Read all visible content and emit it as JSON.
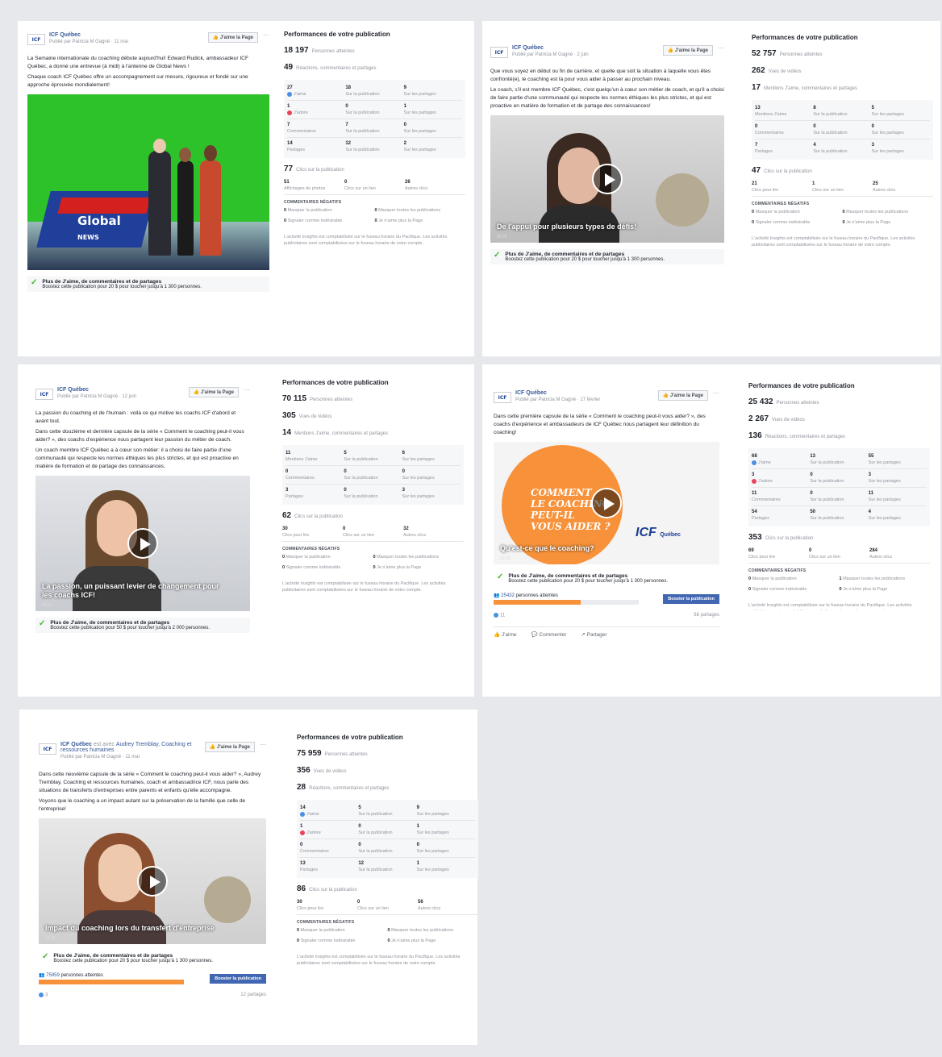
{
  "common": {
    "page_name": "ICF Québec",
    "like_page": "J'aime la Page",
    "perf_title": "Performances de votre publication",
    "reached": "Personnes atteintes",
    "video_views": "Vues de vidéos",
    "reactions": "Réactions, commentaires et partages",
    "mentions": "Mentions J'aime, commentaires et partages",
    "clicks": "Clics sur la publication",
    "lbl_like": "J'aime",
    "lbl_love": "J'adore",
    "lbl_mentions_like": "Mentions J'aime",
    "lbl_comments": "Commentaires",
    "lbl_shares": "Partages",
    "lbl_on_post": "Sur la publication",
    "lbl_on_shares": "Sur les partages",
    "lbl_photo_views": "Affichages de photos",
    "lbl_link_clicks": "Clics sur un lien",
    "lbl_play_clicks": "Clics pour lire",
    "lbl_other_clicks": "Autres clics",
    "neg_title": "COMMENTAIRES NÉGATIFS",
    "neg_hide": "Masquer la publication",
    "neg_hide_all": "Masquer toutes les publications",
    "neg_spam": "Signaler comme indésirable",
    "neg_unlike": "Je n'aime plus la Page",
    "note": "L'activité Insights est comptabilisée sur le fuseau horaire du Pacifique. Les activités publicitaires sont comptabilisées sur le fuseau horaire de votre compte.",
    "boost_title": "Plus de J'aime, de commentaires et de partages",
    "boost_button": "Booster la publication",
    "reach_suffix": "personnes atteintes",
    "act_like": "J'aime",
    "act_comment": "Commenter",
    "act_share": "Partager",
    "brand_orange": "#f7923a",
    "brand_blue": "#4267b2",
    "like_blue": "#4a90e2",
    "love_red": "#e9435a"
  },
  "p1": {
    "meta": "Publié par Patricia M Gagné · 11 mai",
    "text1": "La Semaine internationale du coaching débute aujourd'hui! Edward Rudick, ambassadeur ICF Québec, a donné une entrevue (à midi) à l'antenne de Global News !",
    "text2": "Chaque coach ICF Québec offre un accompagnement sur mesure, rigoureux et fondé sur une approche éprouvée mondialement!",
    "boost_sub": "Boostez cette publication pour 20 $ pour toucher jusqu'à 1 300 personnes.",
    "reach": "18 197",
    "engage": "49",
    "r1": [
      "27",
      "18",
      "9"
    ],
    "r2": [
      "1",
      "0",
      "1"
    ],
    "r3": [
      "7",
      "7",
      "0"
    ],
    "r4": [
      "14",
      "12",
      "2"
    ],
    "clicks": "77",
    "c": [
      "51",
      "0",
      "26"
    ]
  },
  "p2": {
    "meta": "Publié par Patricia M Gagné · 2 juin",
    "text1": "Que vous soyez en début ou fin de carrière, et quelle que soit la situation à laquelle vous êtes confronté(e), le coaching est là pour vous aider à passer au prochain niveau.",
    "text2": "Le coach, s'il est membre ICF Québec, c'est quelqu'un à cœur son métier de coach, et qu'il a choisi de faire partie d'une communauté qui respecte les normes éthiques les plus strictes, et qui est proactive en matière de formation et de partage des connaissances!",
    "caption": "De l'appui pour plusieurs types de défis!",
    "dur": "00:28",
    "boost_sub": "Boostez cette publication pour 20 $ pour toucher jusqu'à 1 300 personnes.",
    "reach": "52 757",
    "views": "262",
    "engage": "17",
    "r1": [
      "13",
      "8",
      "5"
    ],
    "r2": [
      "0",
      "0",
      "0"
    ],
    "r3": [
      "7",
      "4",
      "3"
    ],
    "clicks": "47",
    "c": [
      "21",
      "1",
      "25"
    ]
  },
  "p3": {
    "meta": "Publié par Patricia M Gagné · 12 juin",
    "text1": "La passion du coaching et de l'humain : voilà ce qui motive les coachs ICF d'abord et avant tout.",
    "text2": "Dans cette douzième et dernière capsule de la série « Comment le coaching peut-il vous aider? », des coachs d'expérience nous partagent leur passion du métier de coach.",
    "text3": "Un coach membre ICF Québec a à cœur son métier: il a choisi de faire partie d'une communauté qui respecte les normes éthiques les plus strictes, et qui est proactive en matière de formation et de partage des connaissances.",
    "caption": "La passion, un puissant levier de changement pour les coachs ICF!",
    "dur": "00:33",
    "boost_sub": "Boostez cette publication pour 50 $ pour toucher jusqu'à 2 000 personnes.",
    "reach": "70 115",
    "views": "305",
    "engage": "14",
    "r1": [
      "11",
      "5",
      "6"
    ],
    "r2": [
      "0",
      "0",
      "0"
    ],
    "r3": [
      "3",
      "0",
      "3"
    ],
    "clicks": "62",
    "c": [
      "30",
      "0",
      "32"
    ]
  },
  "p4": {
    "meta": "Publié par Patricia M Gagné · 17 février",
    "text1": "Dans cette première capsule de la série « Comment le coaching peut-il vous aider? », des coachs d'expérience et ambassadeurs de ICF Québec nous partagent leur définition du coaching!",
    "art1": "COMMENT",
    "art2": "LE COACHING",
    "art3": "PEUT-IL",
    "art4": "VOUS AIDER ?",
    "art_brand": "ICF",
    "art_brand_sub": "Québec",
    "caption": "Qu'est-ce que le coaching?",
    "dur": "01:00",
    "boost_sub": "Boostez cette publication pour 20 $ pour toucher jusqu'à 1 300 personnes.",
    "reach_count": "25432",
    "reach_fraction": 0.6,
    "react_count": "11",
    "shares_text": "68 partages",
    "reach": "25 432",
    "views": "2 267",
    "engage": "136",
    "r1": [
      "68",
      "13",
      "55"
    ],
    "r2": [
      "3",
      "0",
      "3"
    ],
    "r3": [
      "11",
      "0",
      "11"
    ],
    "r4": [
      "54",
      "50",
      "4"
    ],
    "clicks": "353",
    "c": [
      "69",
      "0",
      "284"
    ],
    "neg1": "0",
    "neg2": "1"
  },
  "p5": {
    "meta_with": "est avec",
    "tagged": "Audrey Tremblay, Coaching et ressources humaines",
    "meta": "Publié par Patricia M Gagné · 11 mai",
    "text1": "Dans cette neuvième capsule de la série « Comment le coaching peut-il vous aider? », Audrey Tremblay, Coaching et ressources humaines, coach et ambassadrice ICF, nous parle des situations de transferts d'entreprises entre parents et enfants qu'elle accompagne.",
    "text2": "Voyons que le coaching a un impact autant sur la préservation de la famille que celle de l'entreprise!",
    "caption": "Impact du coaching lors du transfert d'entreprise",
    "dur": "00:35",
    "boost_sub": "Boostez cette publication pour 20 $ pour toucher jusqu'à 1 300 personnes.",
    "reach_count": "75959",
    "reach_fraction": 1.0,
    "react_count": "3",
    "shares_text": "12 partages",
    "reach": "75 959",
    "views": "356",
    "engage": "28",
    "r1": [
      "14",
      "5",
      "9"
    ],
    "r2": [
      "1",
      "0",
      "1"
    ],
    "r3": [
      "0",
      "0",
      "0"
    ],
    "r4": [
      "13",
      "12",
      "1"
    ],
    "clicks": "86",
    "c": [
      "30",
      "0",
      "56"
    ]
  }
}
